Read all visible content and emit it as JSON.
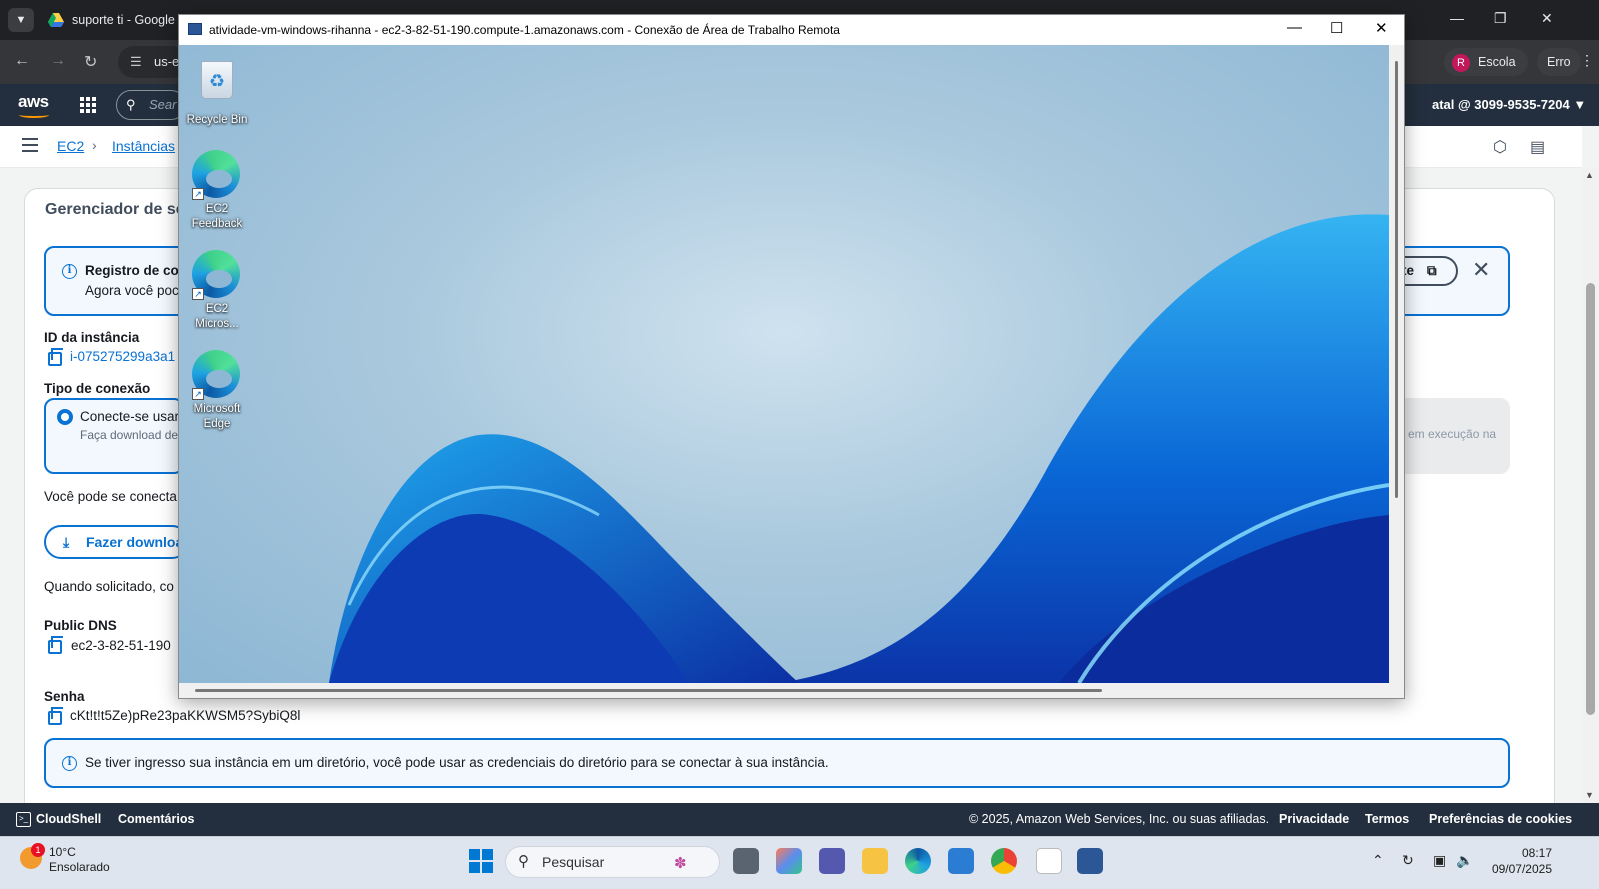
{
  "browser": {
    "tab_title": "suporte ti - Google D",
    "omnibox_text": "us-e",
    "profile_label": "Escola",
    "profile_initial": "R",
    "error_label": "Erro"
  },
  "aws_header": {
    "logo": "aws",
    "search_placeholder": "Sear",
    "account": "atal @ 3099-9535-7204 ▼"
  },
  "breadcrumb": {
    "items": [
      "EC2",
      "Instâncias"
    ]
  },
  "panel": {
    "title": "Gerenciador de se",
    "info_title": "Registro de co",
    "info_sub": "Agora você poc",
    "open_link_label": "te",
    "instance_id_label": "ID da instância",
    "instance_id_value": "i-075275299a3a1",
    "connection_type_label": "Tipo de conexão",
    "radio_option_title": "Conecte-se usar",
    "radio_option_sub": "Faça download de",
    "radio_option2_sub": "em execução na",
    "connect_text": "Você pode se conecta",
    "download_button": "Fazer downloa",
    "prompt_text": "Quando solicitado, co",
    "public_dns_label": "Public DNS",
    "public_dns_value": "ec2-3-82-51-190",
    "password_label": "Senha",
    "password_value": "cKt!t!t5Ze)pRe23paKKWSM5?SybiQ8l",
    "directory_note": "Se tiver ingresso sua instância em um diretório, você pode usar as credenciais do diretório para se conectar à sua instância."
  },
  "footer": {
    "cloudshell": "CloudShell",
    "comments": "Comentários",
    "copyright": "© 2025, Amazon Web Services, Inc. ou suas afiliadas.",
    "privacy": "Privacidade",
    "terms": "Termos",
    "cookies": "Preferências de cookies"
  },
  "rdp_window": {
    "title": "atividade-vm-windows-rihanna - ec2-3-82-51-190.compute-1.amazonaws.com - Conexão de Área de Trabalho Remota",
    "desktop_icons": [
      {
        "label_line1": "Recycle Bin",
        "label_line2": "",
        "icon": "recycle-bin-icon"
      },
      {
        "label_line1": "EC2",
        "label_line2": "Feedback",
        "icon": "edge-icon"
      },
      {
        "label_line1": "EC2",
        "label_line2": "Micros...",
        "icon": "edge-icon"
      },
      {
        "label_line1": "Microsoft",
        "label_line2": "Edge",
        "icon": "edge-icon"
      }
    ]
  },
  "taskbar": {
    "weather_temp": "10°C",
    "weather_desc": "Ensolarado",
    "weather_badge": "1",
    "search_placeholder": "Pesquisar",
    "time": "08:17",
    "date": "09/07/2025"
  },
  "colors": {
    "aws_dark": "#232f3e",
    "aws_link": "#0972d3",
    "browser_dark": "#202124",
    "taskbar": "#dfe5ef"
  }
}
